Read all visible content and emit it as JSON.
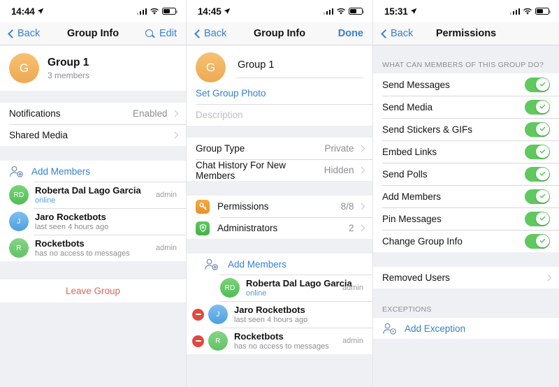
{
  "screens": [
    {
      "status": {
        "time": "14:44",
        "location_icon": "location-arrow-icon",
        "signal_icon": "cellular-signal-icon",
        "wifi_icon": "wifi-icon",
        "battery_icon": "battery-icon"
      },
      "nav": {
        "back": "Back",
        "title": "Group Info",
        "search_icon": "search-icon",
        "action": "Edit"
      },
      "group": {
        "avatar_initial": "G",
        "name": "Group 1",
        "members_count": "3 members"
      },
      "settings": [
        {
          "label": "Notifications",
          "value": "Enabled"
        },
        {
          "label": "Shared Media",
          "value": ""
        }
      ],
      "add_members_label": "Add Members",
      "add_members_icon": "person-add-icon",
      "members": [
        {
          "initials": "RD",
          "color": "green",
          "name": "Roberta Dal Lago Garcia",
          "status": "online",
          "status_style": "online",
          "tag": "admin"
        },
        {
          "initials": "J",
          "color": "blue",
          "name": "Jaro Rocketbots",
          "status": "last seen 4 hours ago",
          "status_style": "",
          "tag": ""
        },
        {
          "initials": "R",
          "color": "green2",
          "name": "Rocketbots",
          "status": "has no access to messages",
          "status_style": "",
          "tag": "admin"
        }
      ],
      "leave_label": "Leave Group"
    },
    {
      "status": {
        "time": "14:45",
        "location_icon": "location-arrow-icon",
        "signal_icon": "cellular-signal-icon",
        "wifi_icon": "wifi-icon",
        "battery_icon": "battery-icon"
      },
      "nav": {
        "back": "Back",
        "title": "Group Info",
        "action": "Done"
      },
      "group": {
        "avatar_initial": "G",
        "name_value": "Group 1"
      },
      "set_photo_label": "Set Group Photo",
      "description_placeholder": "Description",
      "settings": [
        {
          "label": "Group Type",
          "value": "Private"
        },
        {
          "label": "Chat History For New Members",
          "value": "Hidden"
        }
      ],
      "manage": [
        {
          "icon": "key-icon",
          "icon_color": "orange",
          "label": "Permissions",
          "value": "8/8"
        },
        {
          "icon": "shield-badge-icon",
          "icon_color": "green",
          "label": "Administrators",
          "value": "2"
        }
      ],
      "add_members_label": "Add Members",
      "add_members_icon": "person-add-icon",
      "members": [
        {
          "initials": "RD",
          "color": "green",
          "name": "Roberta Dal Lago Garcia",
          "status": "online",
          "status_style": "online",
          "tag": "admin",
          "removable": false
        },
        {
          "initials": "J",
          "color": "blue",
          "name": "Jaro Rocketbots",
          "status": "last seen 4 hours ago",
          "status_style": "",
          "tag": "",
          "removable": true
        },
        {
          "initials": "R",
          "color": "green2",
          "name": "Rocketbots",
          "status": "has no access to messages",
          "status_style": "",
          "tag": "admin",
          "removable": true
        }
      ]
    },
    {
      "status": {
        "time": "15:31",
        "location_icon": "location-arrow-icon",
        "signal_icon": "cellular-signal-icon",
        "wifi_icon": "wifi-icon",
        "battery_icon": "battery-icon"
      },
      "nav": {
        "back": "Back",
        "title": "Permissions"
      },
      "section_header": "WHAT CAN MEMBERS OF THIS GROUP DO?",
      "permissions": [
        {
          "label": "Send Messages",
          "on": true
        },
        {
          "label": "Send Media",
          "on": true
        },
        {
          "label": "Send Stickers & GIFs",
          "on": true
        },
        {
          "label": "Embed Links",
          "on": true
        },
        {
          "label": "Send Polls",
          "on": true
        },
        {
          "label": "Add Members",
          "on": true
        },
        {
          "label": "Pin Messages",
          "on": true
        },
        {
          "label": "Change Group Info",
          "on": true
        }
      ],
      "removed_users_label": "Removed Users",
      "exceptions_header": "EXCEPTIONS",
      "add_exception_label": "Add Exception",
      "add_exception_icon": "person-add-icon"
    }
  ],
  "colors": {
    "accent_blue": "#3580d4",
    "toggle_green": "#5fc960",
    "destructive_red": "#e3655c",
    "remove_red": "#e1493f",
    "page_bg": "#eff0f4",
    "card_bg": "#ffffff",
    "secondary_text": "#8d8e94"
  }
}
